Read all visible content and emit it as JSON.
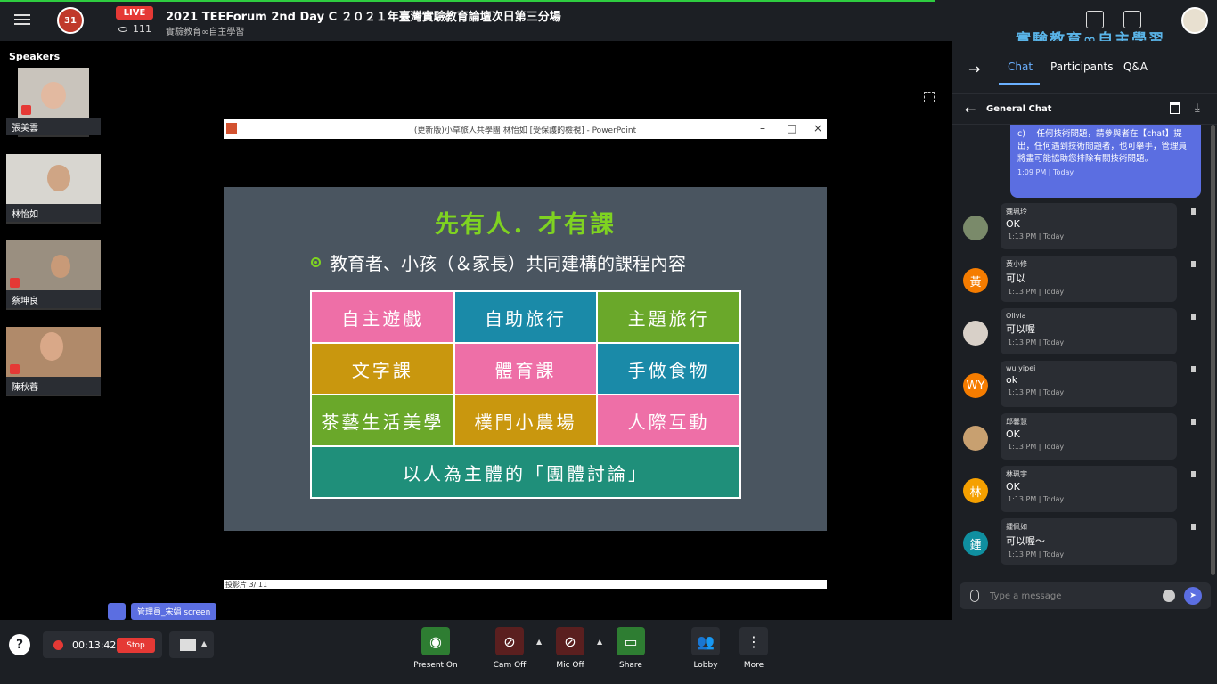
{
  "header": {
    "live": "LIVE",
    "viewers": "111",
    "title": "2021 TEEForum 2nd Day C ２０２１年臺灣實驗教育論壇次日第三分場",
    "subtitle": "實驗教育∞自主學習",
    "logo_text": "31",
    "brand": "實驗教育∞自主學習"
  },
  "speakers": {
    "label": "Speakers",
    "items": [
      {
        "name": "張美雲"
      },
      {
        "name": "林怡如"
      },
      {
        "name": "蔡坤良"
      },
      {
        "name": "陳秋蓉"
      }
    ]
  },
  "presentation": {
    "window_title": "(更新版)小草旅人共學團 林怡如 [受保護的檢視] - PowerPoint",
    "slide_title": "先有人．才有課",
    "bullet": "教育者、小孩（＆家長）共同建構的課程內容",
    "cells": [
      {
        "text": "自主遊戲",
        "color": "#ee6fa7"
      },
      {
        "text": "自助旅行",
        "color": "#1a8aa8"
      },
      {
        "text": "主題旅行",
        "color": "#6aa82a"
      },
      {
        "text": "文字課",
        "color": "#c9970e"
      },
      {
        "text": "體育課",
        "color": "#ee6fa7"
      },
      {
        "text": "手做食物",
        "color": "#1a8aa8"
      },
      {
        "text": "茶藝生活美學",
        "color": "#6aa82a"
      },
      {
        "text": "樸門小農場",
        "color": "#c9970e"
      },
      {
        "text": "人際互動",
        "color": "#ee6fa7"
      }
    ],
    "wide_cell": {
      "text": "以人為主體的「團體討論」",
      "color": "#1f8f7a"
    },
    "status": "投影片 3/ 11",
    "presenter": "管理員_宋娟 screen"
  },
  "panel": {
    "tabs": [
      "Chat",
      "Participants",
      "Q&A"
    ],
    "chat_title": "General Chat",
    "own_message": {
      "text": "c)　 任何技術問題，請參與者在【chat】提出，任何遇到技術問題者，也可舉手，管理員將盡可能協助您排除有關技術問題。",
      "time": "1:09 PM | Today"
    },
    "messages": [
      {
        "sender": "魏珮玲",
        "text": "OK",
        "time": "1:13 PM | Today",
        "avatar": "",
        "avatar_color": "#7a8a6a"
      },
      {
        "sender": "黃小修",
        "text": "可以",
        "time": "1:13 PM | Today",
        "avatar": "黃",
        "avatar_color": "#f57c00"
      },
      {
        "sender": "Olivia",
        "text": "可以喔",
        "time": "1:13 PM | Today",
        "avatar": "",
        "avatar_color": "#d8d0c8"
      },
      {
        "sender": "wu yipei",
        "text": "ok",
        "time": "1:13 PM | Today",
        "avatar": "WY",
        "avatar_color": "#f57c00"
      },
      {
        "sender": "邱馨慧",
        "text": "OK",
        "time": "1:13 PM | Today",
        "avatar": "",
        "avatar_color": "#c8a070"
      },
      {
        "sender": "林珮宇",
        "text": "OK",
        "time": "1:13 PM | Today",
        "avatar": "林",
        "avatar_color": "#f5a000"
      },
      {
        "sender": "鍾佩如",
        "text": "可以喔～",
        "time": "1:13 PM | Today",
        "avatar": "鍾",
        "avatar_color": "#0f8fa0"
      }
    ],
    "input_placeholder": "Type a message"
  },
  "bottom": {
    "record_time": "00:13:42",
    "stop": "Stop",
    "controls": [
      {
        "label": "Present On",
        "color": "#2e7d32"
      },
      {
        "label": "Cam Off",
        "color": "#5a1f1f"
      },
      {
        "label": "Mic Off",
        "color": "#5a1f1f"
      },
      {
        "label": "Share",
        "color": "#2e7d32"
      },
      {
        "label": "Lobby",
        "color": "#2a2d33"
      },
      {
        "label": "More",
        "color": "#2a2d33"
      }
    ]
  }
}
